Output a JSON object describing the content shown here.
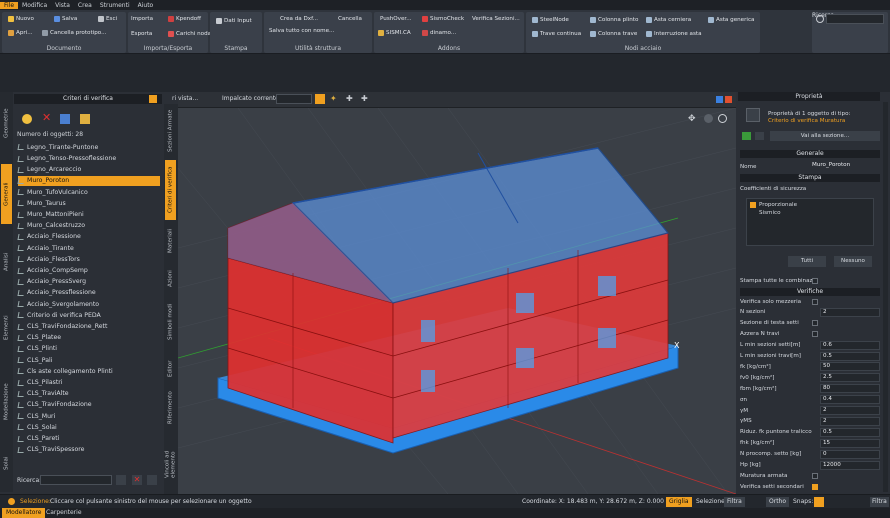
{
  "menu": {
    "items": [
      "File",
      "Modifica",
      "Vista",
      "Crea",
      "Strumenti",
      "Aiuto"
    ]
  },
  "ribbon": {
    "documento": {
      "caption": "Documento",
      "nuovo": "Nuovo",
      "salva": "Salva",
      "esci": "Esci",
      "apri": "Apri...",
      "cancella": "Cancella prototipo..."
    },
    "importa": {
      "caption": "Importa/Esporta",
      "importa": "Importa",
      "esporta": "Esporta",
      "dxf": "Kpendoff",
      "carichi": "Carichi nodali"
    },
    "stampa": {
      "caption": "Stampa",
      "dati": "Dati Input"
    },
    "utilita": {
      "caption": "Utilità struttura",
      "crea": "Crea da Dxf...",
      "cancella": "Cancella",
      "salva": "Salva tutto con nome..."
    },
    "addons": {
      "caption": "Addons",
      "pushover": "PushOver...",
      "sismocheck": "SismoCheck",
      "verifica": "Verifica Sezioni...",
      "sismica": "SISMI.CA",
      "dinamo": "dinamo..."
    },
    "nodi": {
      "caption": "Nodi acciaio",
      "steelnode": "SteelNode",
      "colonna_plinto": "Colonna plinto",
      "asta_cerniera": "Asta cerniera",
      "asta_generica": "Asta generica",
      "trave_continua": "Trave continua",
      "colonna_trave": "Colonna trave",
      "interruzione": "Interruzione asta"
    },
    "ricerca": {
      "caption": "Ricerca"
    }
  },
  "lefttabs": [
    "Geometrie",
    "Generali",
    "Analisi",
    "Elementi",
    "Modellazione",
    "Solai"
  ],
  "leftpanel": {
    "title": "Criteri di verifica",
    "count_label": "Numero di oggetti: 28",
    "items": [
      "Legno_Tirante-Puntone",
      "Legno_Tenso-Pressoflessione",
      "Legno_Arcareccio",
      "Muro_Poroton",
      "Muro_TufoVulcanico",
      "Muro_Taurus",
      "Muro_MattoniPieni",
      " Muro_Calcestruzzo",
      "Acciaio_Flessione",
      "Acciaio_Tirante",
      "Acciaio_FlessTors",
      "Acciaio_CompSemp",
      "Acciaio_PressSverg",
      "Acciaio_Pressflessione",
      "Acciaio_Svergolamento",
      "Criterio di verifica PEDA",
      "CLS_TraviFondazione_Rett",
      "CLS_Platee",
      "CLS_Plinti",
      "CLS_Pali",
      "  Cls aste collegamento Plinti",
      "CLS_Pilastri",
      "CLS_TraviAlte",
      "CLS_TraviFondazione",
      "CLS_Muri",
      "CLS_Solai",
      "CLS_Pareti",
      "CLS_TraviSpessore"
    ],
    "search_label": "Ricerca:"
  },
  "midtabs": [
    "Sezioni Armate",
    "Criteri di verifica",
    "Materiali",
    "Azioni",
    "Simboli modi",
    "Editor",
    "Riferimento",
    "Vincoli ad elemento"
  ],
  "viewport": {
    "tab": "ri vista...",
    "level_label": "Impalcato corrente:",
    "axis_x": "X"
  },
  "rightpanel": {
    "title": "Proprietà",
    "subtitle": "Proprietà di 1 oggetto di tipo:",
    "type": "Criterio di verifica Muratura",
    "nav_button": "Vai alla sezione...",
    "sec_generale": "Generale",
    "name_label": "Nome",
    "name_value": "Muro_Poroton",
    "sec_stampa": "Stampa",
    "coeff_label": "Coefficienti di sicurezza",
    "opt1": "Proporzionale",
    "opt2": "Sismico",
    "btn_all": "Tutti",
    "btn_none": "Nessuno",
    "print_all": "Stampa tutte le combinazioni",
    "sec_verifiche": "Verifiche",
    "rows": [
      {
        "label": "Verifica solo mezzeria",
        "value": ""
      },
      {
        "label": "N sezioni",
        "value": "2"
      },
      {
        "label": "Sezione di testa setti",
        "value": ""
      },
      {
        "label": "Azzera N travi",
        "value": ""
      },
      {
        "label": "L min sezioni setti[m]",
        "value": "0.6"
      },
      {
        "label": "L min sezioni travi[m]",
        "value": "0.5"
      },
      {
        "label": "fk [kg/cm²]",
        "value": "50"
      },
      {
        "label": "fv0 [kg/cm²]",
        "value": "2.5"
      },
      {
        "label": "fbm [kg/cm²]",
        "value": "80"
      },
      {
        "label": "σn",
        "value": "0.4"
      },
      {
        "label": "γM",
        "value": "2"
      },
      {
        "label": "γMS",
        "value": "2"
      },
      {
        "label": "Riduz. fk puntone tralicco",
        "value": "0.5"
      },
      {
        "label": "fhk [kg/cm²]",
        "value": "15"
      },
      {
        "label": "N procomp. setto [kg]",
        "value": "0"
      },
      {
        "label": "Hp [kg]",
        "value": "12000"
      },
      {
        "label": "Muratura armata",
        "value": ""
      },
      {
        "label": "Verifica setti secondari",
        "value": ""
      }
    ]
  },
  "status": {
    "label": "Selezione:",
    "message": "Cliccare col pulsante sinistro del mouse per selezionare un oggetto",
    "coords": "Coordinate: X: 18.483 m, Y: 28.672 m, Z: 0.000 m",
    "griglia": "Griglia",
    "selezione": "Selezione:",
    "filtra": "Filtra",
    "ortho": "Ortho",
    "snaps": "Snaps:",
    "filtra2": "Filtra"
  },
  "bottomtabs": [
    "Modellatore",
    "Carpenterie"
  ],
  "colors": {
    "accent": "#f0a020",
    "wall_red": "#e03030",
    "foundation_blue": "#2a8ae8",
    "roof_blue": "#4a90e0"
  }
}
